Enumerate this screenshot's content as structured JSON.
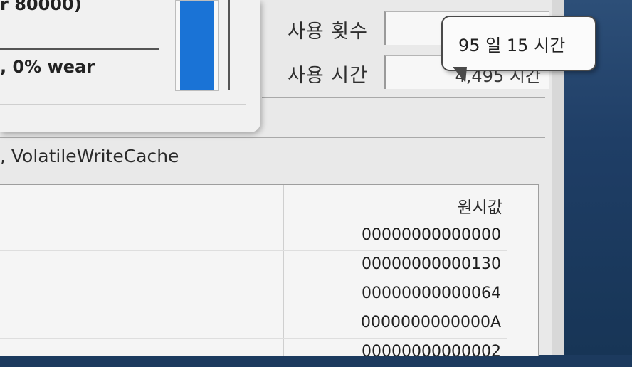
{
  "popup": {
    "line1": "r 80000)",
    "line2": ", 0% wear",
    "gauge_fraction": 1.0
  },
  "stats": {
    "count_label": "사용 횟수",
    "time_label": "사용 시간",
    "time_value": "4,495 시간"
  },
  "tooltip": {
    "text": "95 일 15 시간"
  },
  "features_text": ", VolatileWriteCache",
  "table": {
    "raw_header": "원시값",
    "rows": [
      "00000000000000",
      "00000000000130",
      "00000000000064",
      "0000000000000A",
      "00000000000002"
    ]
  },
  "colors": {
    "gauge_fill": "#1a73d6",
    "background_right": "#1f3e66"
  }
}
